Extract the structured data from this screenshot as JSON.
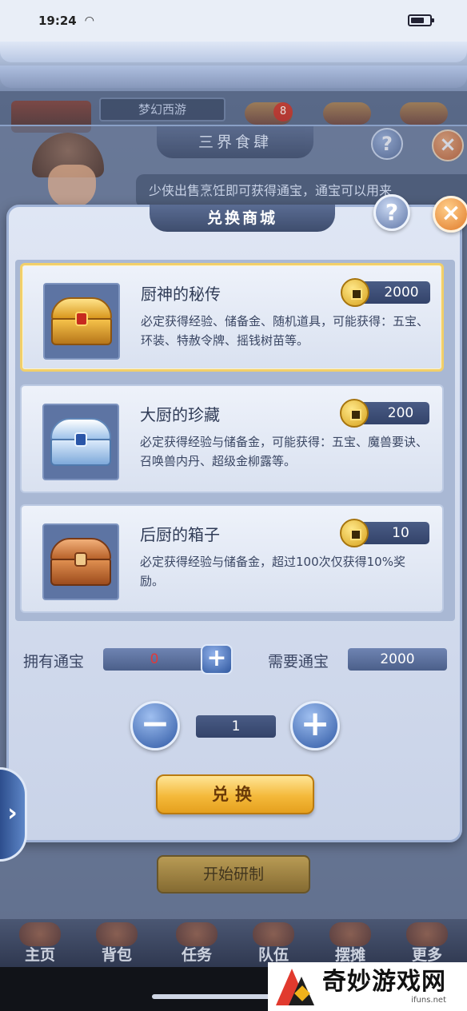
{
  "status_bar": {
    "time": "19:24"
  },
  "background": {
    "server_name": "梦幻西游",
    "badge_count": "8",
    "panel_title": "三界食肆",
    "npc_dialog": "少侠出售烹饪即可获得通宝，通宝可以用来",
    "start_button": "开始研制",
    "help_glyph": "?",
    "close_glyph": "×"
  },
  "modal": {
    "title": "兑换商城",
    "help_glyph": "?",
    "close_glyph": "×",
    "items": [
      {
        "name": "厨神的秘传",
        "price": "2000",
        "desc": "必定获得经验、储备金、随机道具，可能获得：五宝、环装、特赦令牌、摇钱树苗等。",
        "chest_icon": "gold-chest-icon"
      },
      {
        "name": "大厨的珍藏",
        "price": "200",
        "desc": "必定获得经验与储备金，可能获得：五宝、魔兽要诀、召唤兽内丹、超级金柳露等。",
        "chest_icon": "ice-chest-icon"
      },
      {
        "name": "后厨的箱子",
        "price": "10",
        "desc": "必定获得经验与储备金，超过100次仅获得10%奖励。",
        "chest_icon": "bronze-chest-icon"
      }
    ],
    "owned_label": "拥有通宝",
    "owned_value": "0",
    "need_label": "需要通宝",
    "need_value": "2000",
    "quantity": "1",
    "plus_glyph": "+",
    "minus_glyph": "−",
    "exchange_label": "兑换"
  },
  "side_arrow_glyph": "›",
  "bottom_nav": [
    "主页",
    "背包",
    "任务",
    "队伍",
    "摆摊",
    "更多"
  ],
  "watermark": {
    "title": "奇妙游戏网",
    "url": "ifuns.net"
  },
  "colors": {
    "selected_border": "#f1cf6a",
    "owned_value": "#e03a3a",
    "exchange_button": "#f4b93a",
    "modal_banner": "#3e4d6d"
  }
}
